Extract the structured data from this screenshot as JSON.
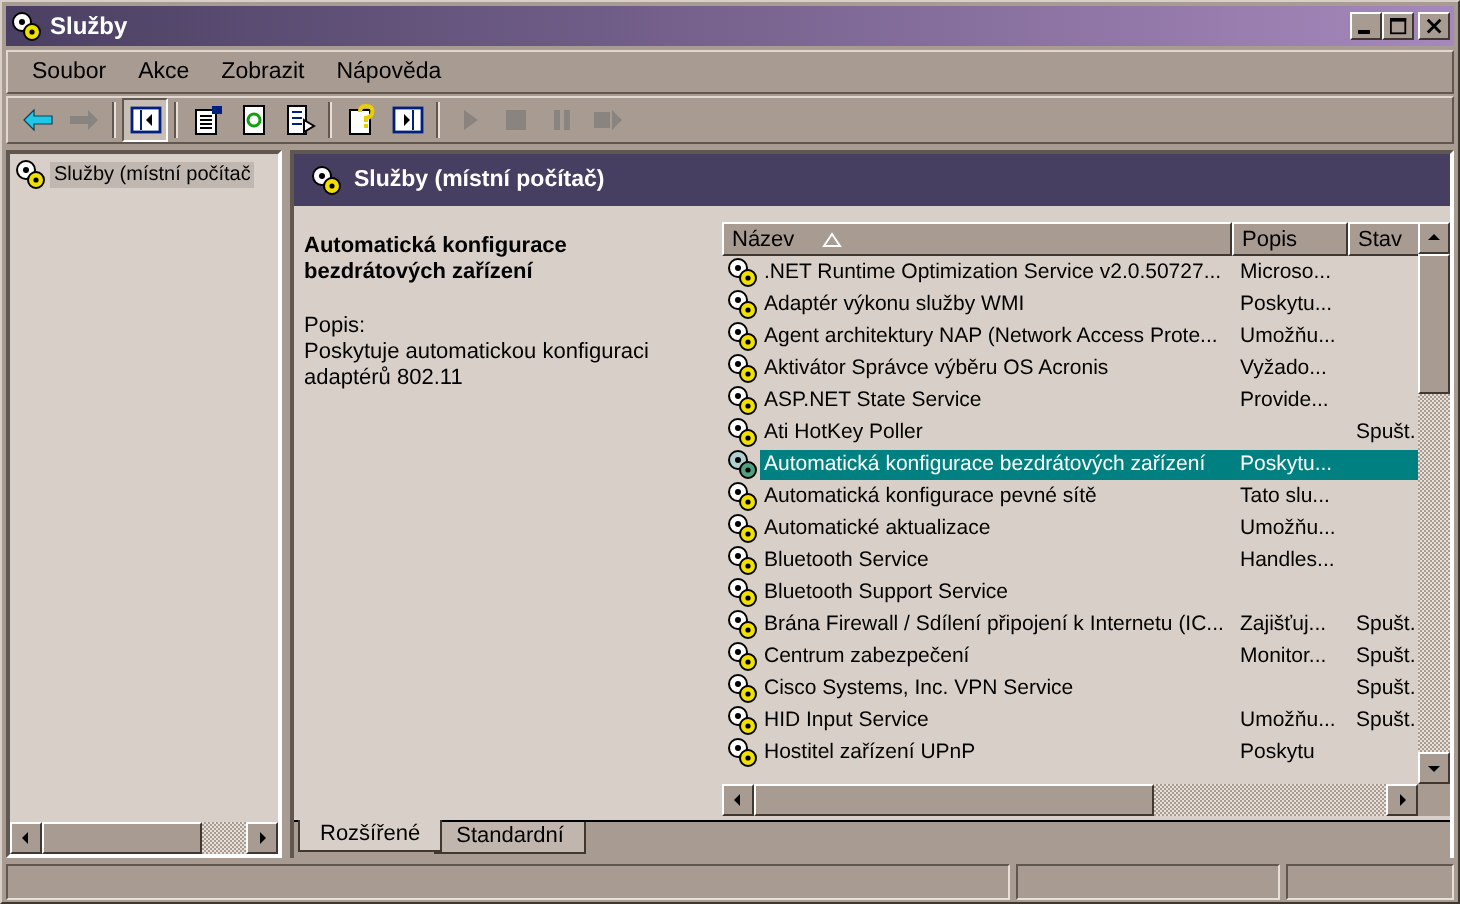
{
  "window": {
    "title": "Služby"
  },
  "menu": [
    {
      "label": "Soubor"
    },
    {
      "label": "Akce"
    },
    {
      "label": "Zobrazit"
    },
    {
      "label": "Nápověda"
    }
  ],
  "toolbar": [
    {
      "kind": "back",
      "disabled": false,
      "pressed": false
    },
    {
      "kind": "forward",
      "disabled": true,
      "pressed": false
    },
    {
      "kind": "sep"
    },
    {
      "kind": "tree",
      "disabled": false,
      "pressed": true
    },
    {
      "kind": "sep"
    },
    {
      "kind": "properties",
      "disabled": false,
      "pressed": false
    },
    {
      "kind": "refresh",
      "disabled": false,
      "pressed": false
    },
    {
      "kind": "export",
      "disabled": false,
      "pressed": false
    },
    {
      "kind": "sep"
    },
    {
      "kind": "help",
      "disabled": false,
      "pressed": false
    },
    {
      "kind": "panel",
      "disabled": false,
      "pressed": false
    },
    {
      "kind": "sep"
    },
    {
      "kind": "play",
      "disabled": true,
      "pressed": false
    },
    {
      "kind": "stop",
      "disabled": true,
      "pressed": false
    },
    {
      "kind": "pause",
      "disabled": true,
      "pressed": false
    },
    {
      "kind": "restart",
      "disabled": true,
      "pressed": false
    }
  ],
  "tree": {
    "items": [
      {
        "label": "Služby (místní počítač",
        "selected": true
      }
    ]
  },
  "pane": {
    "title": "Služby (místní počítač)"
  },
  "details": {
    "title": "Automatická konfigurace bezdrátových zařízení",
    "label": "Popis:",
    "text": "Poskytuje automatickou konfiguraci adaptérů 802.11"
  },
  "table": {
    "columns": [
      {
        "label": "Název",
        "sorted": true
      },
      {
        "label": "Popis"
      },
      {
        "label": "Stav"
      }
    ],
    "rows": [
      {
        "name": ".NET Runtime Optimization Service v2.0.50727...",
        "description": "Microso...",
        "status": "",
        "selected": false
      },
      {
        "name": "Adaptér výkonu služby WMI",
        "description": "Poskytu...",
        "status": "",
        "selected": false
      },
      {
        "name": "Agent architektury NAP (Network Access Prote...",
        "description": "Umožňu...",
        "status": "",
        "selected": false
      },
      {
        "name": "Aktivátor Správce výběru OS Acronis",
        "description": "Vyžado...",
        "status": "",
        "selected": false
      },
      {
        "name": "ASP.NET State Service",
        "description": "Provide...",
        "status": "",
        "selected": false
      },
      {
        "name": "Ati HotKey Poller",
        "description": "",
        "status": "Spušt.",
        "selected": false
      },
      {
        "name": "Automatická konfigurace bezdrátových zařízení",
        "description": "Poskytu...",
        "status": "",
        "selected": true
      },
      {
        "name": "Automatická konfigurace pevné sítě",
        "description": "Tato slu...",
        "status": "",
        "selected": false
      },
      {
        "name": "Automatické aktualizace",
        "description": "Umožňu...",
        "status": "",
        "selected": false
      },
      {
        "name": "Bluetooth Service",
        "description": "Handles...",
        "status": "",
        "selected": false
      },
      {
        "name": "Bluetooth Support Service",
        "description": "",
        "status": "",
        "selected": false
      },
      {
        "name": "Brána Firewall / Sdílení připojení k Internetu (IC...",
        "description": "Zajišťuj...",
        "status": "Spušt.",
        "selected": false
      },
      {
        "name": "Centrum zabezpečení",
        "description": "Monitor...",
        "status": "Spušt.",
        "selected": false
      },
      {
        "name": "Cisco Systems, Inc. VPN Service",
        "description": "",
        "status": "Spušt.",
        "selected": false
      },
      {
        "name": "HID Input Service",
        "description": "Umožňu...",
        "status": "Spušt.",
        "selected": false
      },
      {
        "name": "Hostitel zařízení UPnP",
        "description": "Poskytu",
        "status": "",
        "selected": false
      }
    ]
  },
  "tabs": [
    {
      "label": "Rozšířené",
      "selected": true
    },
    {
      "label": "Standardní",
      "selected": false
    }
  ]
}
